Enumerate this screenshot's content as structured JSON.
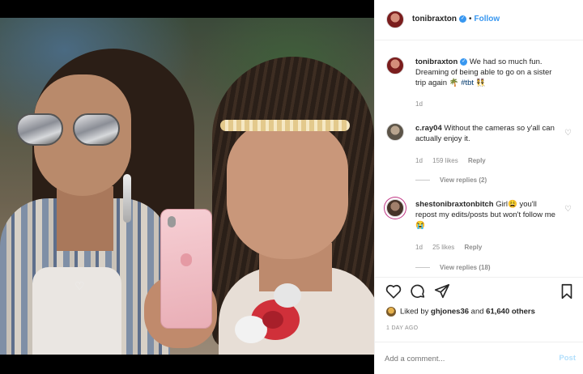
{
  "post": {
    "username": "tonibraxton",
    "follow_label": "Follow",
    "separator": "•"
  },
  "caption": {
    "username": "tonibraxton",
    "text": "We had so much fun. Dreaming of being able to go on a sister trip again 🌴",
    "hashtag": "#tbt",
    "emoji_end": "👯",
    "age": "1d"
  },
  "comments": [
    {
      "username": "c.ray04",
      "text": "Without the cameras so y'all can actually enjoy it.",
      "age": "1d",
      "likes": "159 likes",
      "reply_label": "Reply",
      "view_replies": "View replies (2)"
    },
    {
      "username": "shestonibraxtonbitch",
      "text": "Girl😩 you'll repost my edits/posts but won't follow me😭",
      "age": "1d",
      "likes": "25 likes",
      "reply_label": "Reply",
      "view_replies": "View replies (18)"
    }
  ],
  "likes_line": {
    "prefix": "Liked by",
    "user": "ghjones36",
    "middle": "and",
    "others": "61,640 others"
  },
  "timestamp": "1 DAY AGO",
  "add_comment": {
    "placeholder": "Add a comment...",
    "post_label": "Post"
  },
  "icons": {
    "like": "heart-icon",
    "comment": "comment-icon",
    "share": "share-icon",
    "save": "bookmark-icon",
    "verified": "verified-badge-icon"
  },
  "colors": {
    "link": "#3897f0",
    "hashtag": "#00376b",
    "muted": "#8e8e8e",
    "post_disabled": "#b2dffc"
  }
}
